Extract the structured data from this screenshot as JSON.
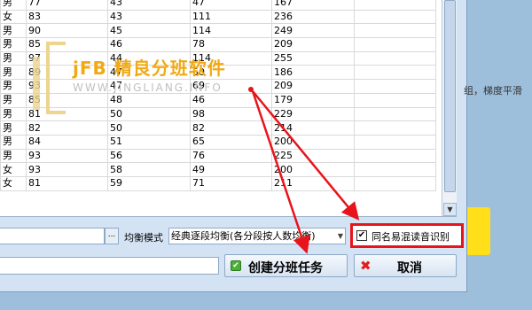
{
  "grid": {
    "rows": [
      [
        "男",
        "77",
        "43",
        "47",
        "167"
      ],
      [
        "女",
        "83",
        "43",
        "111",
        "236"
      ],
      [
        "男",
        "90",
        "45",
        "114",
        "249"
      ],
      [
        "男",
        "85",
        "46",
        "78",
        "209"
      ],
      [
        "男",
        "97",
        "44",
        "114",
        "255"
      ],
      [
        "男",
        "89",
        "47",
        "50",
        "186"
      ],
      [
        "男",
        "93",
        "47",
        "69",
        "209"
      ],
      [
        "男",
        "85",
        "48",
        "46",
        "179"
      ],
      [
        "男",
        "81",
        "50",
        "98",
        "229"
      ],
      [
        "男",
        "82",
        "50",
        "82",
        "214"
      ],
      [
        "男",
        "84",
        "51",
        "65",
        "200"
      ],
      [
        "男",
        "93",
        "56",
        "76",
        "225"
      ],
      [
        "女",
        "93",
        "58",
        "49",
        "200"
      ],
      [
        "女",
        "81",
        "59",
        "71",
        "211"
      ]
    ]
  },
  "watermark": {
    "title": "jFB 精良分班软件",
    "url": "WWW.JINGLIANG.INFO"
  },
  "form": {
    "browse_label": "...",
    "mode_label": "均衡模式",
    "mode_value": "经典逐段均衡(各分段按人数均衡)",
    "homophone_label": "同名易混读音识别",
    "homophone_checked": "✔"
  },
  "buttons": {
    "create_label": "创建分班任务",
    "cancel_label": "取消"
  },
  "side_text": "组，梯度平滑",
  "colors": {
    "annotation_red": "#e8141c",
    "watermark_orange": "#f1a913",
    "accent_yellow": "#ffde1a"
  }
}
